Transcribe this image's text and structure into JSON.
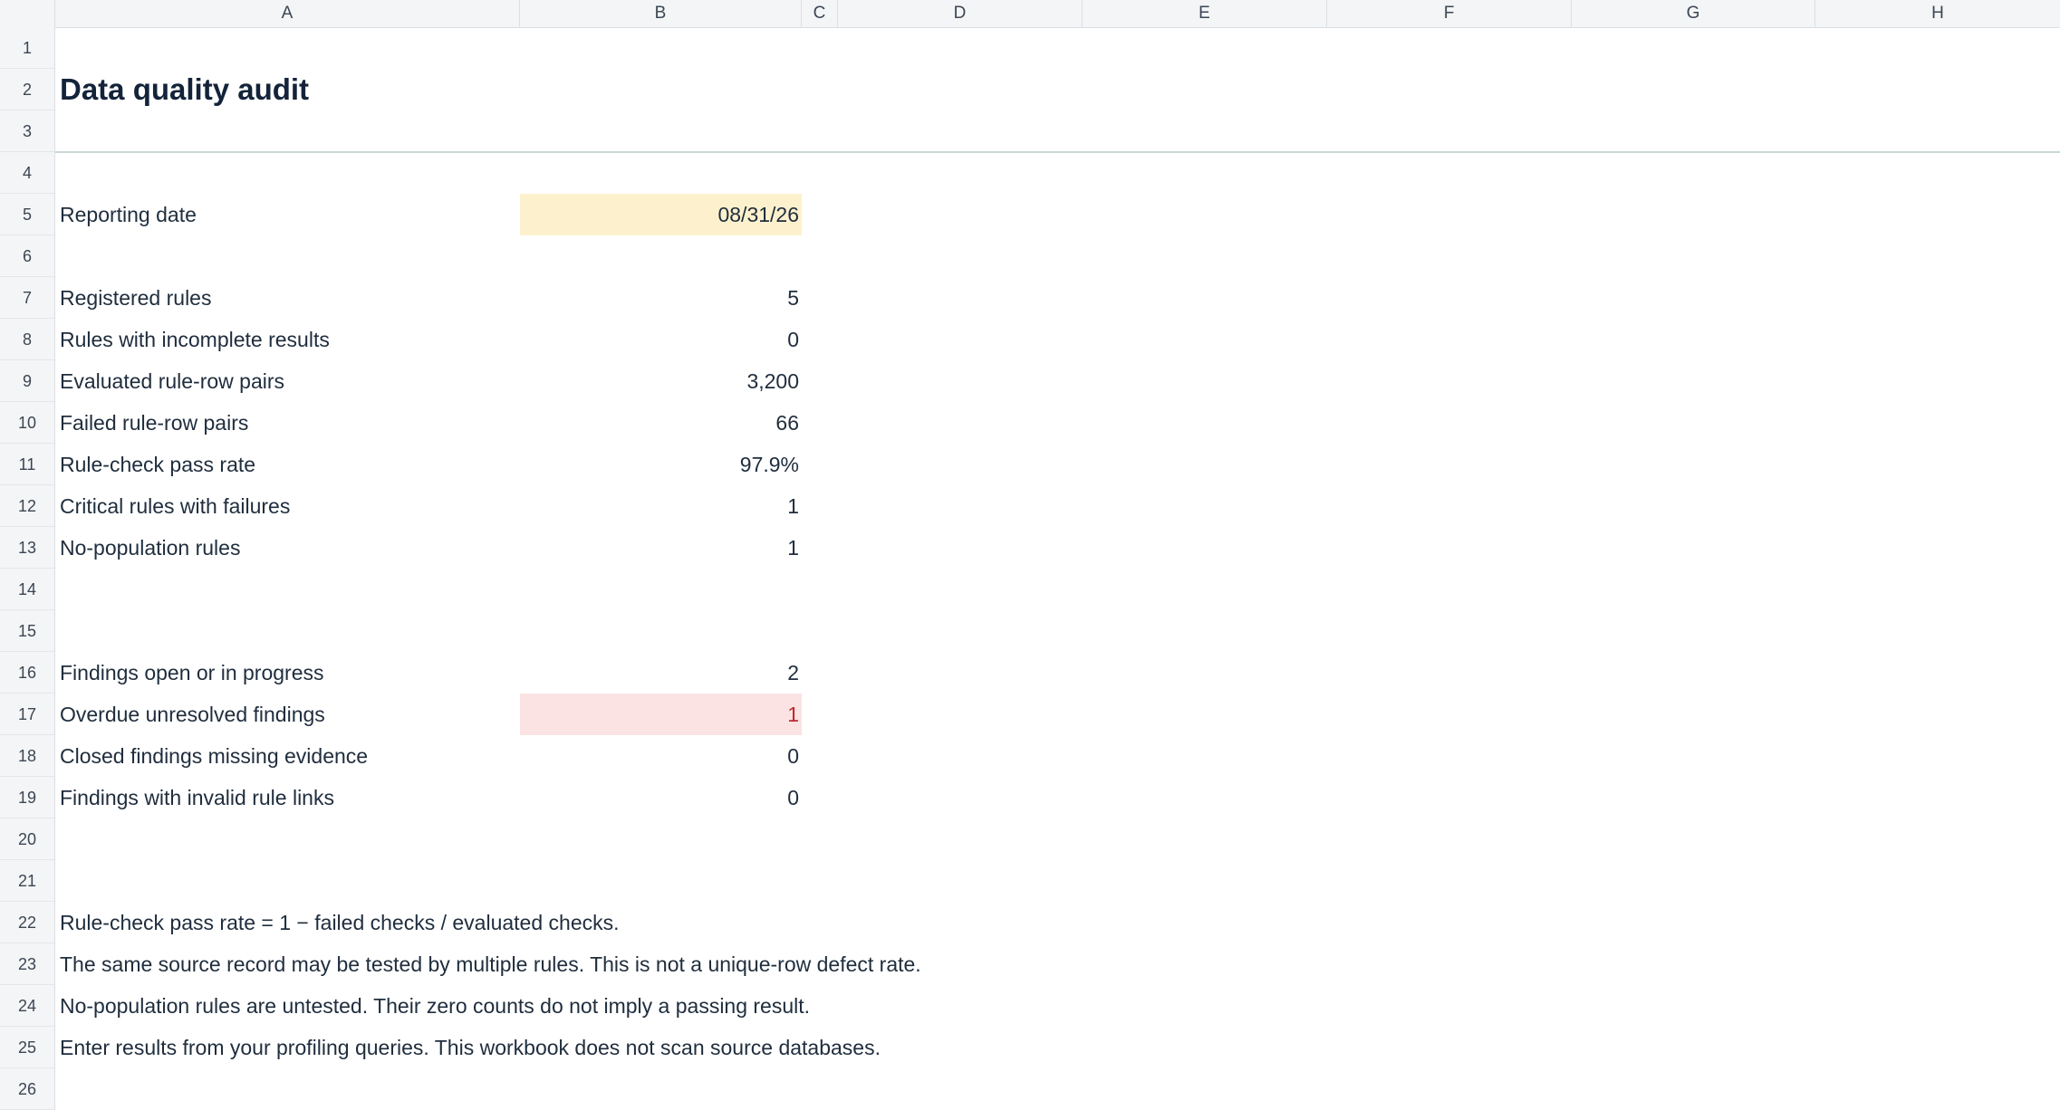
{
  "columns": [
    "A",
    "B",
    "C",
    "D",
    "E",
    "F",
    "G",
    "H"
  ],
  "rows": [
    "1",
    "2",
    "3",
    "4",
    "5",
    "6",
    "7",
    "8",
    "9",
    "10",
    "11",
    "12",
    "13",
    "14",
    "15",
    "16",
    "17",
    "18",
    "19",
    "20",
    "21",
    "22",
    "23",
    "24",
    "25",
    "26"
  ],
  "title": "Data quality audit",
  "reporting": {
    "label": "Reporting date",
    "value": "08/31/26"
  },
  "rules_summary": [
    {
      "label": "Registered rules",
      "value": "5"
    },
    {
      "label": "Rules with incomplete results",
      "value": "0"
    },
    {
      "label": "Evaluated rule-row pairs",
      "value": "3,200"
    },
    {
      "label": "Failed rule-row pairs",
      "value": "66"
    },
    {
      "label": "Rule-check pass rate",
      "value": "97.9%"
    },
    {
      "label": "Critical rules with failures",
      "value": "1"
    },
    {
      "label": "No-population rules",
      "value": "1"
    }
  ],
  "findings_summary": [
    {
      "label": "Findings open or in progress",
      "value": "2"
    },
    {
      "label": "Overdue unresolved findings",
      "value": "1"
    },
    {
      "label": "Closed findings missing evidence",
      "value": "0"
    },
    {
      "label": "Findings with invalid rule links",
      "value": "0"
    }
  ],
  "notes": [
    "Rule-check pass rate = 1 − failed checks / evaluated checks.",
    "The same source record may be tested by multiple rules. This is not a unique-row defect rate.",
    "No-population rules are untested. Their zero counts do not imply a passing result.",
    "Enter results from your profiling queries. This workbook does not scan source databases."
  ],
  "colors": {
    "input_fill": "#fdf1cd",
    "alert_fill": "#fbe3e3",
    "alert_text": "#c0272d",
    "title": "#13233a"
  }
}
